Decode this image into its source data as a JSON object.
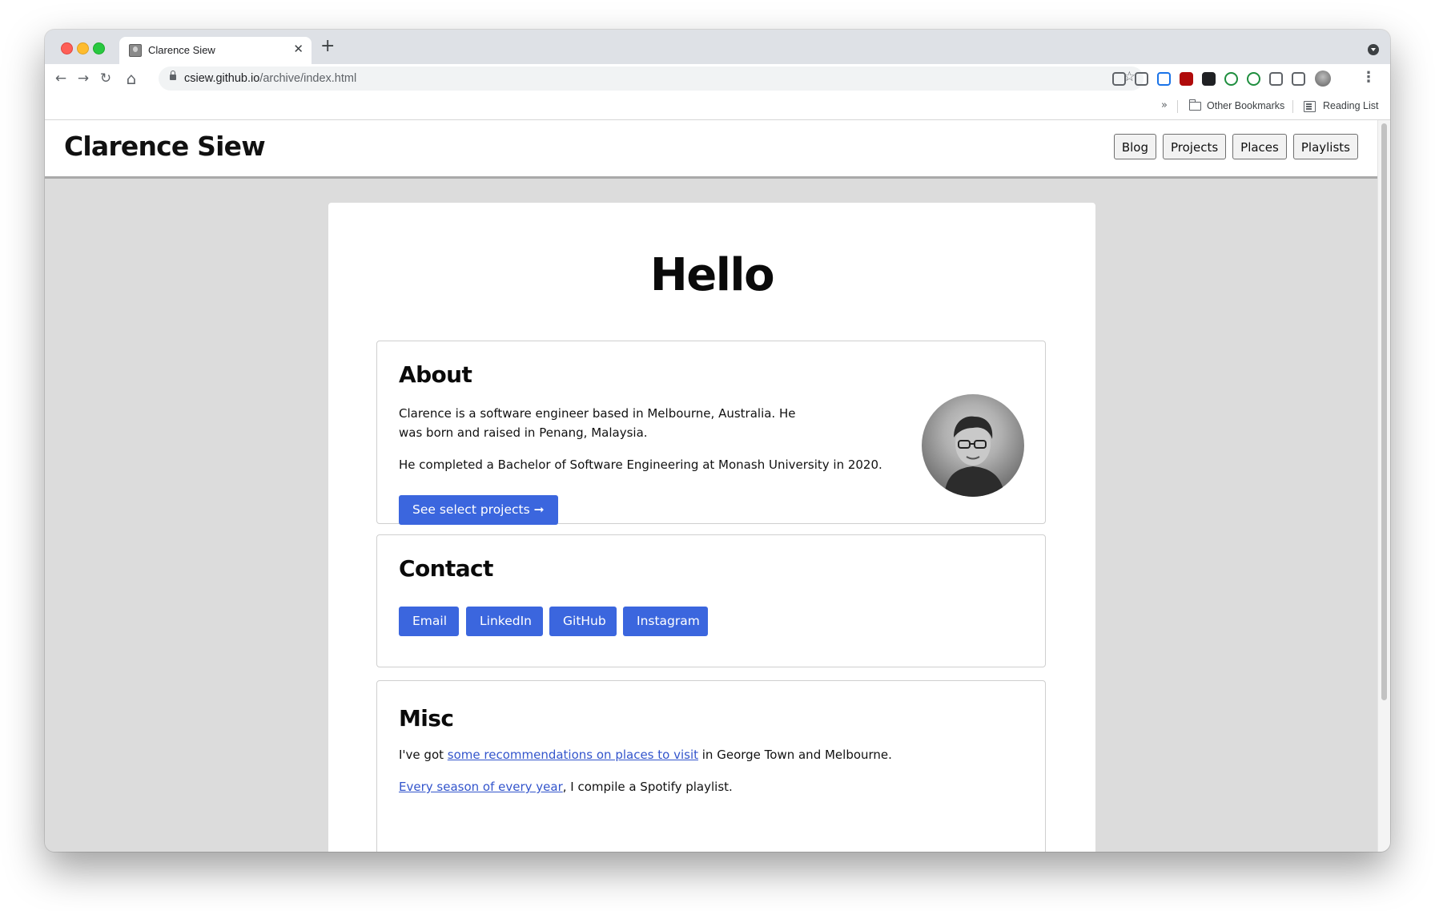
{
  "browser": {
    "tab_title": "Clarence Siew",
    "tab_close": "✕",
    "new_tab": "+",
    "back": "←",
    "forward": "→",
    "reload": "↻",
    "home": "⌂",
    "url_host": "csiew.github.io",
    "url_path": "/archive/index.html",
    "star": "☆",
    "menu": "⋮",
    "bookmarks_overflow": "»",
    "other_bookmarks": "Other Bookmarks",
    "reading_list": "Reading List",
    "extension_colors": [
      "#5f6368",
      "#5f6368",
      "#1a73e8",
      "#b00b0b",
      "#202124",
      "#1e8e3e",
      "#1e8e3e",
      "#5f6368",
      "#5f6368"
    ]
  },
  "site": {
    "title": "Clarence Siew",
    "nav": [
      "Blog",
      "Projects",
      "Places",
      "Playlists"
    ]
  },
  "main": {
    "heading": "Hello",
    "about": {
      "title": "About",
      "para1": "Clarence is a software engineer based in Melbourne, Australia. He was born and raised in Penang, Malaysia.",
      "para2": "He completed a Bachelor of Software Engineering at Monash University in 2020.",
      "button": "See select projects ➞"
    },
    "contact": {
      "title": "Contact",
      "buttons": [
        "Email",
        "LinkedIn",
        "GitHub",
        "Instagram"
      ]
    },
    "misc": {
      "title": "Misc",
      "line1_pre": "I've got ",
      "line1_link": "some recommendations on places to visit",
      "line1_post": " in George Town and Melbourne.",
      "line2_link": "Every season of every year",
      "line2_post": ", I compile a Spotify playlist."
    }
  },
  "colors": {
    "accent": "#3b66de",
    "link": "#3355cc",
    "page_bg": "#dcdcdc"
  }
}
